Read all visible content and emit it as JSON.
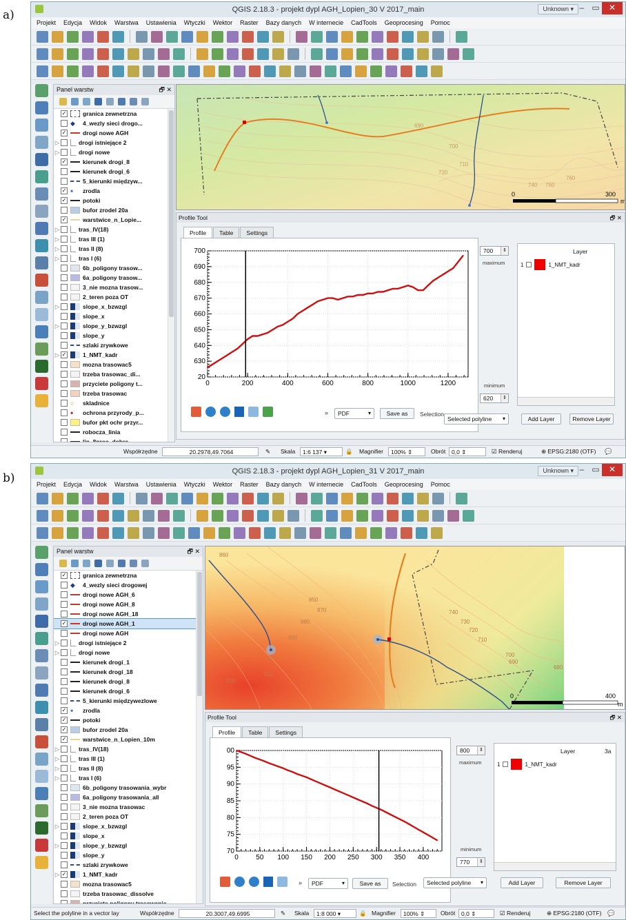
{
  "labels": {
    "a": "a)",
    "b": "b)"
  },
  "common": {
    "menu": [
      "Projekt",
      "Edycja",
      "Widok",
      "Warstwa",
      "Ustawienia",
      "Wtyczki",
      "Wektor",
      "Raster",
      "Bazy danych",
      "W internecie",
      "CadTools",
      "Geoprocesing",
      "Pomoc"
    ],
    "unknown": "Unknown ▾",
    "panel_title": "Panel warstw",
    "profile_title": "Profile Tool",
    "tabs": [
      "Profile",
      "Table",
      "Settings"
    ],
    "maximum": "maximum",
    "minimum": "minimum",
    "layer_header": "Layer",
    "pdf": "PDF",
    "save_as": "Save as",
    "selection": "Selection",
    "selected_polyline": "Selected polyline",
    "add_layer": "Add Layer",
    "remove_layer": "Remove Layer",
    "coords_label": "Współrzędne",
    "scale_label": "Skala",
    "magnifier_label": "Magnifier",
    "magnifier": "100%",
    "rotation_label": "Obrót",
    "rotation": "0,0",
    "render": "Renderuj",
    "epsg": "EPSG:2180 (OTF)",
    "layer_row_num": "1",
    "layer_row_name": "1_NMT_kadr",
    "scale_unit": "m",
    "scale_zero": "0"
  },
  "a": {
    "title": "QGIS 2.18.3 - projekt dypl AGH_Lopien_30 V 2017_main",
    "layers": [
      {
        "n": "granica zewnetrzna",
        "c": true,
        "t": "poly"
      },
      {
        "n": "4_wezly sieci drogo...",
        "c": false,
        "t": "pt"
      },
      {
        "n": "drogi nowe AGH",
        "c": true,
        "t": "line",
        "col": "#c0392b"
      },
      {
        "n": "drogi istniejące 2",
        "c": false,
        "t": "grp",
        "e": true
      },
      {
        "n": "drogi nowe",
        "c": false,
        "t": "grp",
        "e": true
      },
      {
        "n": "kierunek drogi_8",
        "c": true,
        "t": "line",
        "col": "#222"
      },
      {
        "n": "kierunek drogi_6",
        "c": false,
        "t": "line",
        "col": "#222"
      },
      {
        "n": "5_kierunki międzyw...",
        "c": false,
        "t": "dash"
      },
      {
        "n": "zrodla",
        "c": true,
        "t": "pt2"
      },
      {
        "n": "potoki",
        "c": true,
        "t": "line",
        "col": "#222"
      },
      {
        "n": "bufor zrodel 20a",
        "c": false,
        "t": "fill",
        "col": "#b7cde8"
      },
      {
        "n": "warstwice_n_Lopie...",
        "c": true,
        "t": "line",
        "col": "#e8d79a"
      },
      {
        "n": "tras_IV(18)",
        "c": false,
        "t": "grp",
        "e": true
      },
      {
        "n": "tras III (1)",
        "c": false,
        "t": "grp",
        "e": true
      },
      {
        "n": "tras II (8)",
        "c": false,
        "t": "grp",
        "e": true
      },
      {
        "n": "tras I (6)",
        "c": false,
        "t": "grp",
        "e": true
      },
      {
        "n": "6b_poligony trasow...",
        "c": false,
        "t": "fill",
        "col": "#dfe6ee"
      },
      {
        "n": "6a_poligony trasow...",
        "c": false,
        "t": "fill",
        "col": "#b7b9e8"
      },
      {
        "n": "3_nie mozna trasow...",
        "c": false,
        "t": "fill",
        "col": "#f4f4f4"
      },
      {
        "n": "2_teren poza OT",
        "c": false,
        "t": "fill",
        "col": "#f4f4f4"
      },
      {
        "n": "slope_x_bzwzgl",
        "c": false,
        "t": "ras",
        "e": true
      },
      {
        "n": "slope_x",
        "c": false,
        "t": "ras"
      },
      {
        "n": "slope_y_bzwzgl",
        "c": false,
        "t": "ras",
        "e": true
      },
      {
        "n": "slope_y",
        "c": false,
        "t": "ras"
      },
      {
        "n": "szlaki zrywkowe",
        "c": false,
        "t": "dash"
      },
      {
        "n": "1_NMT_kadr",
        "c": true,
        "t": "ras",
        "e": true
      },
      {
        "n": "mozna trasowac5",
        "c": false,
        "t": "fill",
        "col": "#f5e0c8"
      },
      {
        "n": "trzeba trasowac_di...",
        "c": false,
        "t": "fill",
        "col": "#f4f4f4"
      },
      {
        "n": "przyciete poligony t...",
        "c": false,
        "t": "fill",
        "col": "#d9b2ad"
      },
      {
        "n": "trzeba trasowac",
        "c": false,
        "t": "fill",
        "col": "#f2d3c0"
      },
      {
        "n": "skladnice",
        "c": false,
        "t": "pt3"
      },
      {
        "n": "ochrona przyrody_p...",
        "c": false,
        "t": "pt4"
      },
      {
        "n": "bufor pkt ochr przyr...",
        "c": false,
        "t": "fill",
        "col": "#fff27a"
      },
      {
        "n": "robocza_linia",
        "c": false,
        "t": "line",
        "col": "#222"
      },
      {
        "n": "lin_8proc_dobra",
        "c": false,
        "t": "line",
        "col": "#222"
      }
    ],
    "max_val": "700",
    "min_val": "620",
    "coords": "20.2978,49.7064",
    "scale": "1:6 137",
    "status_msg": "",
    "scale_end": "300",
    "contours": [
      "690",
      "700",
      "710",
      "720",
      "740",
      "750",
      "760"
    ],
    "chart_data": {
      "type": "line",
      "title": "",
      "x": [
        0,
        25,
        50,
        75,
        100,
        125,
        150,
        175,
        200,
        225,
        250,
        275,
        300,
        325,
        350,
        375,
        400,
        425,
        450,
        475,
        500,
        525,
        550,
        575,
        600,
        625,
        650,
        675,
        700,
        725,
        750,
        775,
        800,
        825,
        850,
        875,
        900,
        925,
        950,
        975,
        1000,
        1025,
        1050,
        1075,
        1100,
        1125,
        1150,
        1175,
        1200,
        1225,
        1250,
        1275
      ],
      "y": [
        626,
        628,
        630,
        632,
        634,
        636,
        638,
        641,
        644,
        646,
        646,
        647,
        648,
        650,
        652,
        653,
        655,
        657,
        660,
        662,
        664,
        666,
        668,
        669,
        670,
        670,
        669,
        670,
        671,
        671,
        672,
        672,
        673,
        673,
        674,
        674,
        675,
        676,
        676,
        677,
        678,
        677,
        675,
        675,
        678,
        681,
        683,
        685,
        687,
        689,
        693,
        697
      ],
      "xticks": [
        0,
        200,
        400,
        600,
        800,
        1000,
        1200
      ],
      "yticks": [
        620,
        630,
        640,
        650,
        660,
        670,
        680,
        690,
        700
      ],
      "ytick_labels": [
        "20",
        "630",
        "640",
        "650",
        "660",
        "670",
        "680",
        "690",
        "700"
      ],
      "xlim": [
        0,
        1300
      ],
      "ylim": [
        620,
        700
      ],
      "marker_x": 190,
      "color": "#cc1111"
    }
  },
  "b": {
    "title": "QGIS 2.18.3 - projekt dypl AGH_Lopien_31 V 2017_main",
    "layers": [
      {
        "n": "granica zewnetrzna",
        "c": true,
        "t": "poly"
      },
      {
        "n": "4_wezly sieci drogowej",
        "c": false,
        "t": "pt"
      },
      {
        "n": "drogi nowe AGH_6",
        "c": false,
        "t": "line",
        "col": "#c0392b"
      },
      {
        "n": "drogi nowe AGH_8",
        "c": false,
        "t": "line",
        "col": "#c0392b"
      },
      {
        "n": "drogi nowe AGH_18",
        "c": false,
        "t": "line",
        "col": "#c0392b"
      },
      {
        "n": "drogi nowe AGH_1",
        "c": true,
        "t": "line",
        "col": "#c0392b",
        "sel": true
      },
      {
        "n": "drogi nowe AGH",
        "c": false,
        "t": "line",
        "col": "#c0392b"
      },
      {
        "n": "drogi istniejące 2",
        "c": false,
        "t": "grp",
        "e": true
      },
      {
        "n": "drogi nowe",
        "c": false,
        "t": "grp",
        "e": true
      },
      {
        "n": "kierunek drogi_1",
        "c": false,
        "t": "line",
        "col": "#222"
      },
      {
        "n": "kierunek drogi_18",
        "c": false,
        "t": "line",
        "col": "#222"
      },
      {
        "n": "kierunek drogi_8",
        "c": false,
        "t": "line",
        "col": "#222"
      },
      {
        "n": "kierunek drogi_6",
        "c": false,
        "t": "line",
        "col": "#222"
      },
      {
        "n": "5_kierunki międzywezlowe",
        "c": false,
        "t": "dash"
      },
      {
        "n": "zrodla",
        "c": true,
        "t": "pt2"
      },
      {
        "n": "potoki",
        "c": true,
        "t": "line",
        "col": "#222"
      },
      {
        "n": "bufor zrodel 20a",
        "c": true,
        "t": "fill",
        "col": "#b7cde8"
      },
      {
        "n": "warstwice_n_Lopien_10m",
        "c": true,
        "t": "line",
        "col": "#e8d79a"
      },
      {
        "n": "tras_IV(18)",
        "c": false,
        "t": "grp",
        "e": true
      },
      {
        "n": "tras III (1)",
        "c": false,
        "t": "grp",
        "e": true
      },
      {
        "n": "tras II (8)",
        "c": false,
        "t": "grp",
        "e": true
      },
      {
        "n": "tras I (6)",
        "c": false,
        "t": "grp",
        "e": true
      },
      {
        "n": "6b_poligony trasowania_wybr",
        "c": false,
        "t": "fill",
        "col": "#dfe6ee"
      },
      {
        "n": "6a_poligony trasowania_all",
        "c": false,
        "t": "fill",
        "col": "#b7b9e8"
      },
      {
        "n": "3_nie mozna trasowac",
        "c": false,
        "t": "fill",
        "col": "#f4f4f4"
      },
      {
        "n": "2_teren poza OT",
        "c": false,
        "t": "fill",
        "col": "#f4f4f4"
      },
      {
        "n": "slope_x_bzwzgl",
        "c": false,
        "t": "ras",
        "e": true
      },
      {
        "n": "slope_x",
        "c": false,
        "t": "ras"
      },
      {
        "n": "slope_y_bzwzgl",
        "c": false,
        "t": "ras",
        "e": true
      },
      {
        "n": "slope_y",
        "c": false,
        "t": "ras"
      },
      {
        "n": "szlaki zrywkowe",
        "c": false,
        "t": "dash"
      },
      {
        "n": "1_NMT_kadr",
        "c": true,
        "t": "ras",
        "e": true
      },
      {
        "n": "mozna trasowac5",
        "c": false,
        "t": "fill",
        "col": "#f5e0c8"
      },
      {
        "n": "trzeba trasowac_dissolve",
        "c": false,
        "t": "fill",
        "col": "#f4f4f4"
      },
      {
        "n": "przyciete poligony trasowania",
        "c": false,
        "t": "fill",
        "col": "#d9b2ad"
      }
    ],
    "max_val": "800",
    "min_val": "770",
    "coords": "20.3007,49.6995",
    "scale": "1:8 000",
    "status_msg": "Select the polyline in a vector lay",
    "scale_end": "400",
    "contours": [
      "860",
      "850",
      "870",
      "880",
      "890",
      "900",
      "910",
      "920",
      "740",
      "730",
      "720",
      "710",
      "700",
      "690",
      "680"
    ],
    "chart_data": {
      "type": "line",
      "title": "",
      "x": [
        0,
        10,
        20,
        30,
        40,
        50,
        60,
        70,
        80,
        90,
        100,
        110,
        120,
        130,
        140,
        150,
        160,
        170,
        180,
        190,
        200,
        210,
        220,
        230,
        240,
        250,
        260,
        270,
        280,
        290,
        300,
        310,
        320,
        330,
        340,
        350,
        360,
        370,
        380,
        390,
        400,
        410,
        420,
        430
      ],
      "y": [
        800,
        799.5,
        799,
        798.4,
        797.8,
        797.3,
        796.8,
        796.2,
        795.7,
        795.2,
        794.7,
        794.1,
        793.6,
        793.0,
        792.5,
        792.0,
        791.4,
        790.8,
        790.2,
        789.6,
        789.0,
        788.4,
        787.8,
        787.2,
        786.6,
        786.0,
        785.4,
        784.8,
        784.2,
        783.5,
        782.9,
        782.3,
        781.6,
        780.9,
        780.2,
        779.5,
        778.8,
        778.0,
        777.2,
        776.4,
        775.6,
        774.8,
        774.0,
        773.2
      ],
      "xticks": [
        0,
        50,
        100,
        150,
        200,
        250,
        300,
        350,
        400
      ],
      "yticks": [
        770,
        775,
        780,
        785,
        790,
        795,
        800
      ],
      "ytick_labels": [
        "70",
        "75",
        "80",
        "85",
        "90",
        "95",
        "00"
      ],
      "xlim": [
        0,
        440
      ],
      "ylim": [
        770,
        800
      ],
      "marker_x": 305,
      "color": "#cc1111"
    }
  }
}
